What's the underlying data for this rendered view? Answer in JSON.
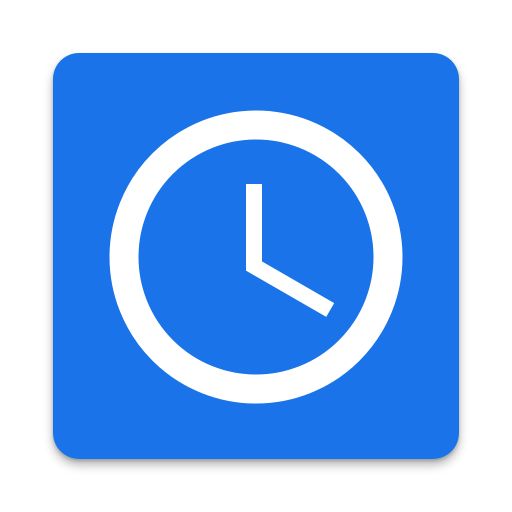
{
  "icon": {
    "name": "clock-icon",
    "background_color": "#1a73e8",
    "foreground_color": "#ffffff",
    "clock": {
      "hour_hand_angle_deg": 120,
      "minute_hand_angle_deg": 0
    }
  }
}
